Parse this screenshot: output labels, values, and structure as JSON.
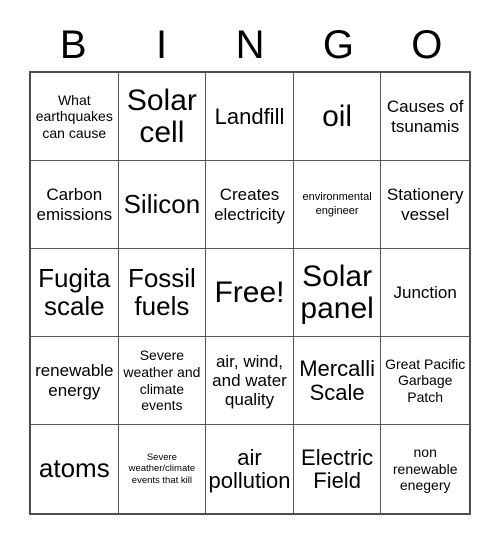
{
  "card": {
    "title_letters": [
      "B",
      "I",
      "N",
      "G",
      "O"
    ],
    "grid_color": "#4d4d4d",
    "background_color": "#ffffff",
    "text_color": "#000000",
    "rows": 5,
    "columns": 5,
    "cells": [
      {
        "text": "What earthquakes can cause",
        "size": "sm"
      },
      {
        "text": "Solar cell",
        "size": "xxl"
      },
      {
        "text": "Landfill",
        "size": "lg"
      },
      {
        "text": "oil",
        "size": "xxl"
      },
      {
        "text": "Causes of tsunamis",
        "size": "md"
      },
      {
        "text": "Carbon emissions",
        "size": "md"
      },
      {
        "text": "Silicon",
        "size": "xl"
      },
      {
        "text": "Creates electricity",
        "size": "md"
      },
      {
        "text": "environmental engineer",
        "size": "xs"
      },
      {
        "text": "Stationery vessel",
        "size": "md"
      },
      {
        "text": "Fugita scale",
        "size": "xl"
      },
      {
        "text": "Fossil fuels",
        "size": "xl"
      },
      {
        "text": "Free!",
        "size": "xxl"
      },
      {
        "text": "Solar panel",
        "size": "xxl"
      },
      {
        "text": "Junction",
        "size": "md"
      },
      {
        "text": "renewable energy",
        "size": "md"
      },
      {
        "text": "Severe weather and climate events",
        "size": "sm"
      },
      {
        "text": "air, wind, and water quality",
        "size": "md"
      },
      {
        "text": "Mercalli Scale",
        "size": "lg"
      },
      {
        "text": "Great Pacific Garbage Patch",
        "size": "sm"
      },
      {
        "text": "atoms",
        "size": "xl"
      },
      {
        "text": "Severe weather/climate events that kill",
        "size": "xxs"
      },
      {
        "text": "air pollution",
        "size": "lg"
      },
      {
        "text": "Electric Field",
        "size": "lg"
      },
      {
        "text": "non renewable enegery",
        "size": "sm"
      }
    ]
  }
}
